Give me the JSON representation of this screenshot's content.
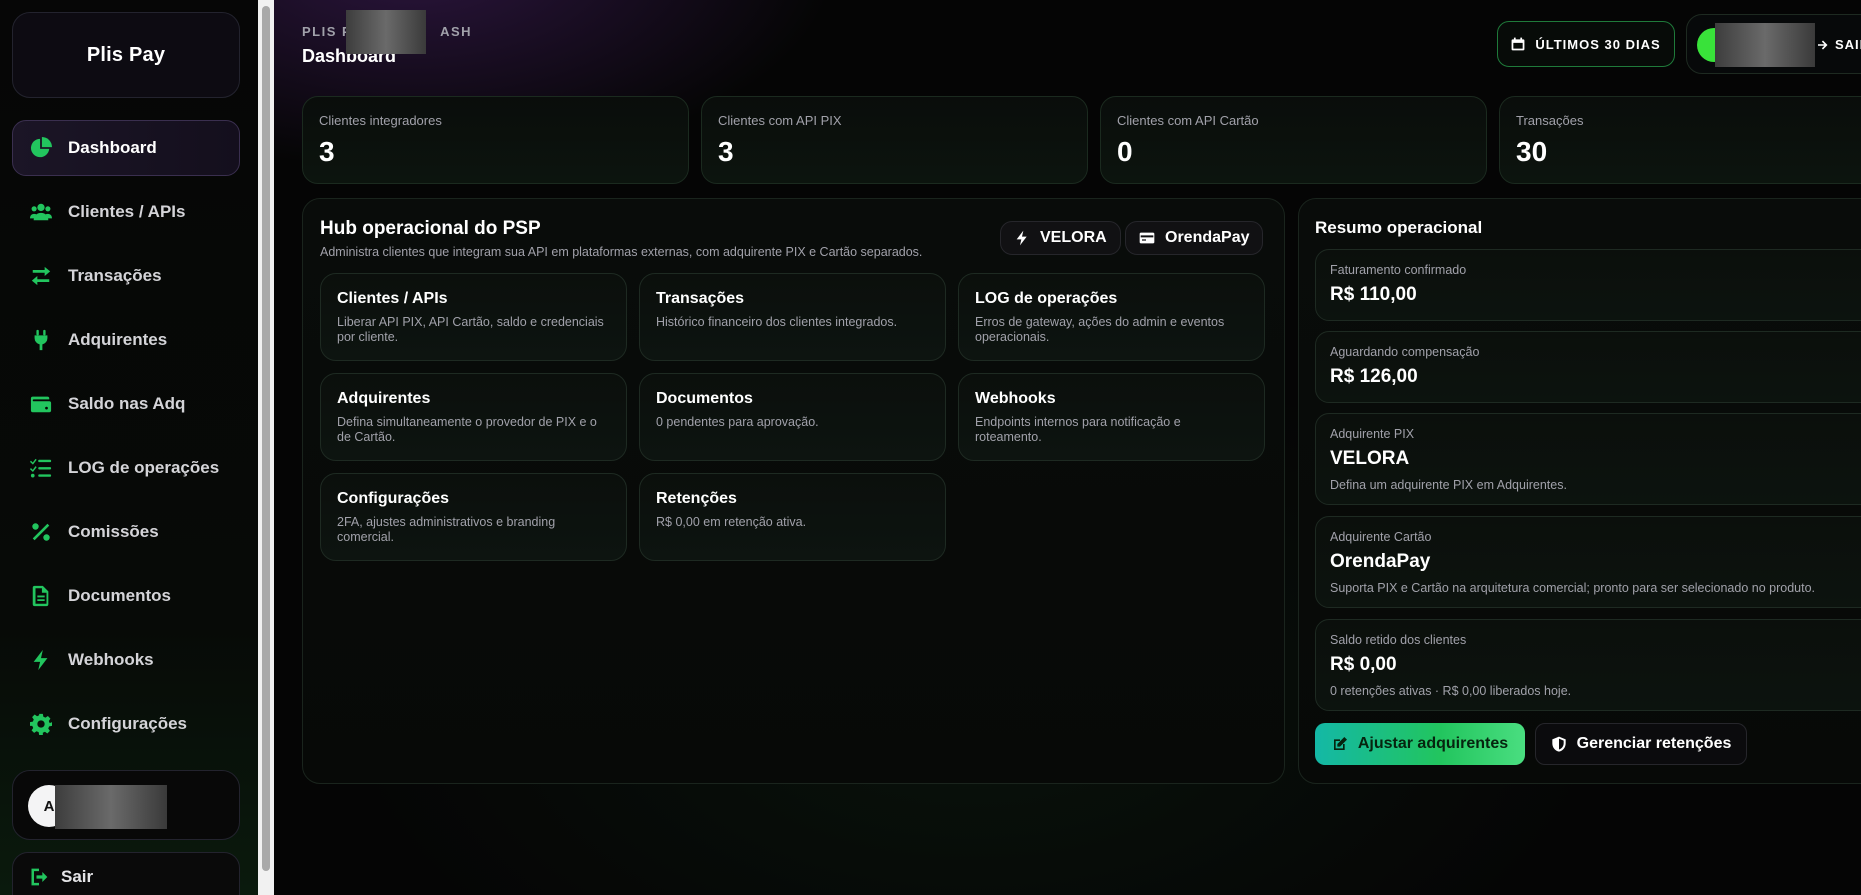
{
  "sidebar": {
    "brand": "Plis Pay",
    "items": [
      {
        "label": "Dashboard",
        "icon": "pie-chart-icon",
        "active": true
      },
      {
        "label": "Clientes / APIs",
        "icon": "users-icon"
      },
      {
        "label": "Transações",
        "icon": "arrows-exchange-icon"
      },
      {
        "label": "Adquirentes",
        "icon": "plug-icon"
      },
      {
        "label": "Saldo nas Adq",
        "icon": "wallet-icon"
      },
      {
        "label": "LOG de operações",
        "icon": "list-check-icon"
      },
      {
        "label": "Comissões",
        "icon": "percent-icon"
      },
      {
        "label": "Documentos",
        "icon": "file-icon"
      },
      {
        "label": "Webhooks",
        "icon": "bolt-icon"
      },
      {
        "label": "Configurações",
        "icon": "gear-icon"
      }
    ],
    "user": {
      "avatar_initial": "A"
    },
    "logout_label": "Sair"
  },
  "header": {
    "breadcrumb_start": "PLIS PA",
    "breadcrumb_end": "ASH",
    "title": "Dashboard",
    "range_button": "ÚLTIMOS 30 DIAS",
    "avatar_initial": "A",
    "logout_label": "SAIR"
  },
  "stats": [
    {
      "label": "Clientes integradores",
      "value": "3"
    },
    {
      "label": "Clientes com API PIX",
      "value": "3"
    },
    {
      "label": "Clientes com API Cartão",
      "value": "0"
    },
    {
      "label": "Transações",
      "value": "30"
    }
  ],
  "hub": {
    "title": "Hub operacional do PSP",
    "subtitle": "Administra clientes que integram sua API em plataformas externas, com adquirente PIX e Cartão separados.",
    "pills": [
      {
        "label": "VELORA",
        "icon": "bolt-icon"
      },
      {
        "label": "OrendaPay",
        "icon": "credit-card-icon"
      }
    ],
    "cards": [
      {
        "title": "Clientes / APIs",
        "desc": "Liberar API PIX, API Cartão, saldo e credenciais por cliente."
      },
      {
        "title": "Transações",
        "desc": "Histórico financeiro dos clientes integrados."
      },
      {
        "title": "LOG de operações",
        "desc": "Erros de gateway, ações do admin e eventos operacionais."
      },
      {
        "title": "Adquirentes",
        "desc": "Defina simultaneamente o provedor de PIX e o de Cartão."
      },
      {
        "title": "Documentos",
        "desc": "0 pendentes para aprovação."
      },
      {
        "title": "Webhooks",
        "desc": "Endpoints internos para notificação e roteamento."
      },
      {
        "title": "Configurações",
        "desc": "2FA, ajustes administrativos e branding comercial."
      },
      {
        "title": "Retenções",
        "desc": "R$ 0,00 em retenção ativa."
      }
    ]
  },
  "resumo": {
    "title": "Resumo operacional",
    "items": [
      {
        "label": "Faturamento confirmado",
        "value": "R$ 110,00",
        "desc": ""
      },
      {
        "label": "Aguardando compensação",
        "value": "R$ 126,00",
        "desc": ""
      },
      {
        "label": "Adquirente PIX",
        "value": "VELORA",
        "desc": "Defina um adquirente PIX em Adquirentes."
      },
      {
        "label": "Adquirente Cartão",
        "value": "OrendaPay",
        "desc": "Suporta PIX e Cartão na arquitetura comercial; pronto para ser selecionado no produto."
      },
      {
        "label": "Saldo retido dos clientes",
        "value": "R$ 0,00",
        "desc": "0 retenções ativas · R$ 0,00 liberados hoje."
      }
    ],
    "adjust_button": "Ajustar adquirentes",
    "retention_button": "Gerenciar retenções"
  },
  "colors": {
    "accent": "#22c55e",
    "background": "#050505",
    "active_nav": "#1b1526"
  }
}
